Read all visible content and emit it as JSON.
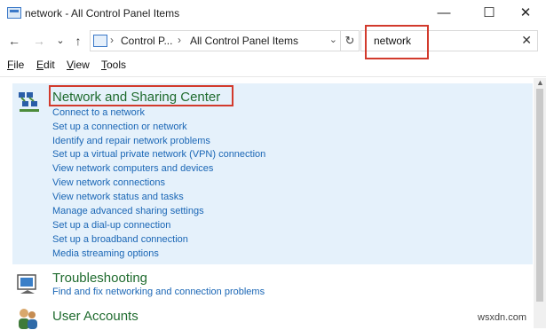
{
  "window": {
    "title": "network - All Control Panel Items",
    "min": "—",
    "max": "☐",
    "close": "✕"
  },
  "nav": {
    "back": "←",
    "forward": "→",
    "recent": "⌄",
    "up": "↑",
    "crumbs": [
      "Control P...",
      "All Control Panel Items"
    ],
    "crumb_sep": "›",
    "dropdown": "⌄",
    "refresh": "↻",
    "search_value": "network",
    "search_clear": "✕"
  },
  "menu": [
    {
      "accel": "F",
      "rest": "ile"
    },
    {
      "accel": "E",
      "rest": "dit"
    },
    {
      "accel": "V",
      "rest": "iew"
    },
    {
      "accel": "T",
      "rest": "ools"
    }
  ],
  "categories": {
    "network": {
      "title": "Network and Sharing Center",
      "tasks": [
        "Connect to a network",
        "Set up a connection or network",
        "Identify and repair network problems",
        "Set up a virtual private network (VPN) connection",
        "View network computers and devices",
        "View network connections",
        "View network status and tasks",
        "Manage advanced sharing settings",
        "Set up a dial-up connection",
        "Set up a broadband connection",
        "Media streaming options"
      ]
    },
    "troubleshooting": {
      "title": "Troubleshooting",
      "tasks": [
        "Find and fix networking and connection problems"
      ]
    },
    "accounts": {
      "title": "User Accounts",
      "tasks": []
    }
  },
  "watermark": "wsxdn.com",
  "colors": {
    "highlight": "#e5f1fb",
    "link": "#1a66b5",
    "category": "#1f6b2e",
    "annotation": "#d23a2c"
  }
}
